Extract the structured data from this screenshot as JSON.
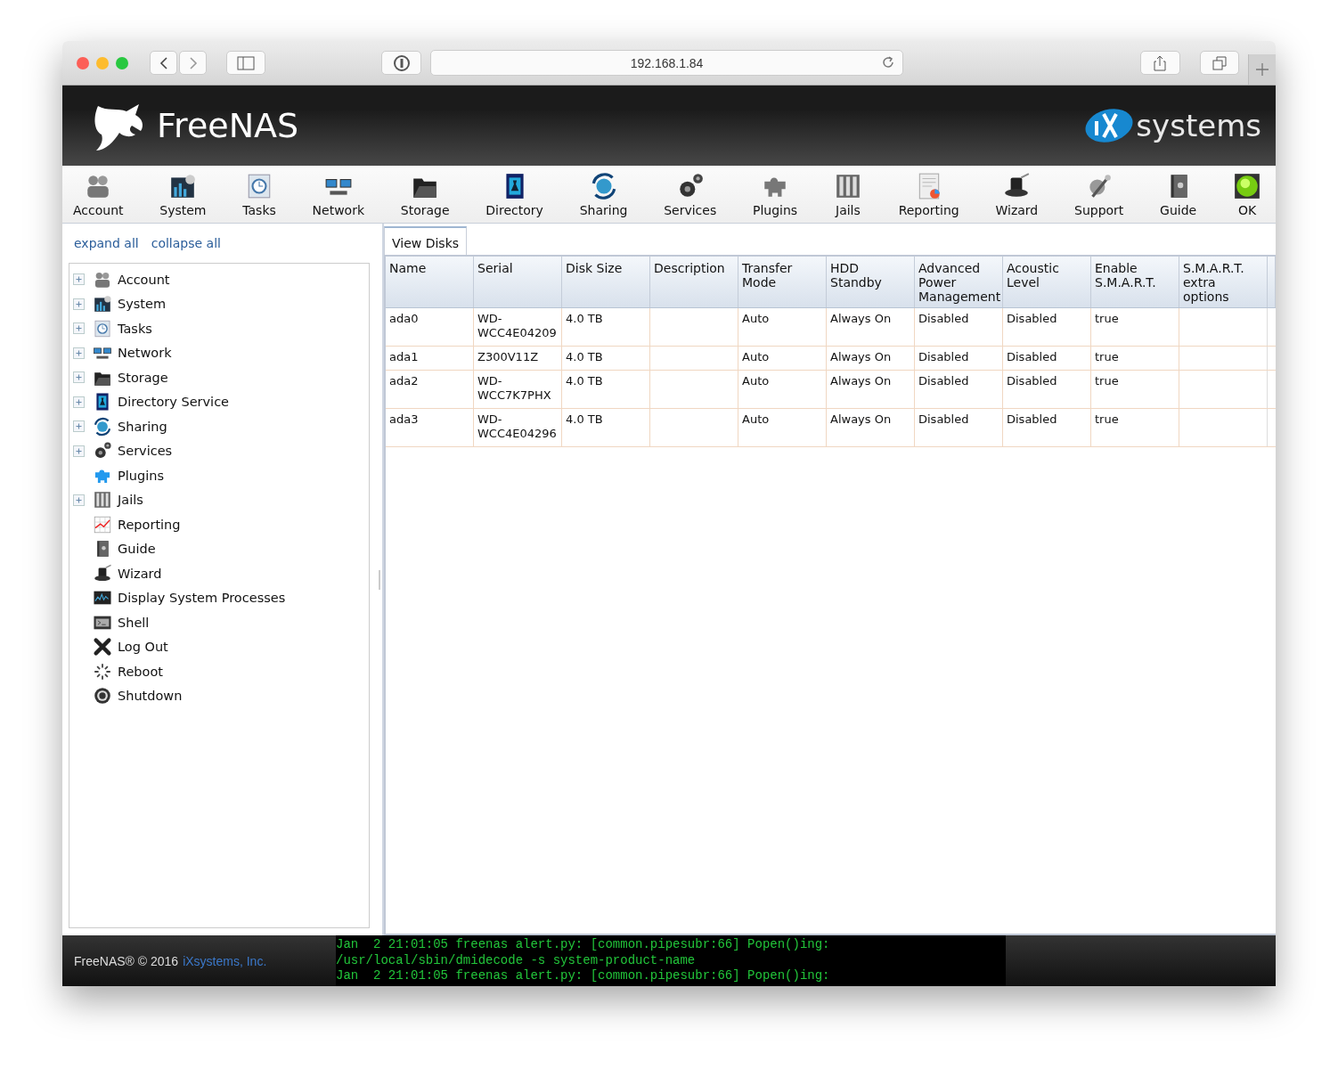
{
  "browser": {
    "address": "192.168.1.84"
  },
  "header": {
    "logo_text": "FreeNAS",
    "vendor_logo_text": "systems"
  },
  "toolbar": [
    {
      "label": "Account"
    },
    {
      "label": "System"
    },
    {
      "label": "Tasks"
    },
    {
      "label": "Network"
    },
    {
      "label": "Storage"
    },
    {
      "label": "Directory"
    },
    {
      "label": "Sharing"
    },
    {
      "label": "Services"
    },
    {
      "label": "Plugins"
    },
    {
      "label": "Jails"
    },
    {
      "label": "Reporting"
    },
    {
      "label": "Wizard"
    },
    {
      "label": "Support"
    },
    {
      "label": "Guide"
    },
    {
      "label": "OK"
    }
  ],
  "sidebar": {
    "links": [
      "expand all",
      "collapse all"
    ],
    "items": [
      {
        "label": "Account",
        "expandable": true
      },
      {
        "label": "System",
        "expandable": true
      },
      {
        "label": "Tasks",
        "expandable": true
      },
      {
        "label": "Network",
        "expandable": true
      },
      {
        "label": "Storage",
        "expandable": true
      },
      {
        "label": "Directory Service",
        "expandable": true
      },
      {
        "label": "Sharing",
        "expandable": true
      },
      {
        "label": "Services",
        "expandable": true
      },
      {
        "label": "Plugins",
        "expandable": false
      },
      {
        "label": "Jails",
        "expandable": true
      },
      {
        "label": "Reporting",
        "expandable": false
      },
      {
        "label": "Guide",
        "expandable": false
      },
      {
        "label": "Wizard",
        "expandable": false
      },
      {
        "label": "Display System Processes",
        "expandable": false
      },
      {
        "label": "Shell",
        "expandable": false
      },
      {
        "label": "Log Out",
        "expandable": false
      },
      {
        "label": "Reboot",
        "expandable": false
      },
      {
        "label": "Shutdown",
        "expandable": false
      }
    ]
  },
  "tabs": [
    {
      "label": "View Disks",
      "selected": true
    }
  ],
  "table": {
    "columns": [
      "Name",
      "Serial",
      "Disk Size",
      "Description",
      "Transfer Mode",
      "HDD Standby",
      "Advanced Power Management",
      "Acoustic Level",
      "Enable S.M.A.R.T.",
      "S.M.A.R.T. extra options"
    ],
    "rows": [
      [
        "ada0",
        "WD-WCC4E04209",
        "4.0 TB",
        "",
        "Auto",
        "Always On",
        "Disabled",
        "Disabled",
        "true",
        ""
      ],
      [
        "ada1",
        "Z300V11Z",
        "4.0 TB",
        "",
        "Auto",
        "Always On",
        "Disabled",
        "Disabled",
        "true",
        ""
      ],
      [
        "ada2",
        "WD-WCC7K7PHX",
        "4.0 TB",
        "",
        "Auto",
        "Always On",
        "Disabled",
        "Disabled",
        "true",
        ""
      ],
      [
        "ada3",
        "WD-WCC4E04296",
        "4.0 TB",
        "",
        "Auto",
        "Always On",
        "Disabled",
        "Disabled",
        "true",
        ""
      ]
    ]
  },
  "footer": {
    "copyright": "FreeNAS® © 2016",
    "vendor_link": "iXsystems, Inc.",
    "log": [
      "Jan  2 21:01:05 freenas alert.py: [common.pipesubr:66] Popen()ing:",
      "/usr/local/sbin/dmidecode -s system-product-name",
      "Jan  2 21:01:05 freenas alert.py: [common.pipesubr:66] Popen()ing:"
    ]
  }
}
